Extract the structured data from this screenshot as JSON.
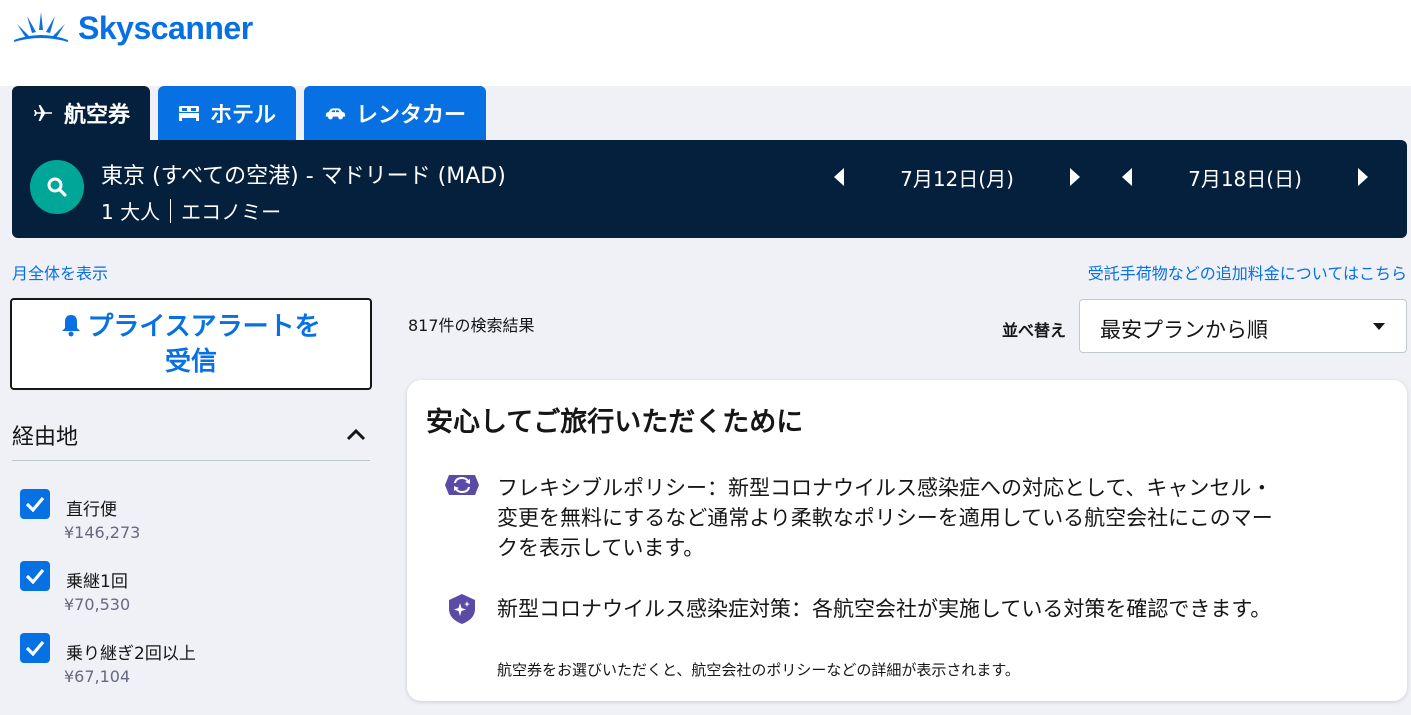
{
  "brand": {
    "name": "Skyscanner",
    "color": "#0770e3"
  },
  "tabs": [
    {
      "label": "航空券",
      "icon": "plane-icon",
      "active": true
    },
    {
      "label": "ホテル",
      "icon": "bed-icon",
      "active": false
    },
    {
      "label": "レンタカー",
      "icon": "car-icon",
      "active": false
    }
  ],
  "search": {
    "route": "東京 (すべての空港) - マドリード (MAD)",
    "passengers": "1 大人",
    "cabin": "エコノミー",
    "depart_date": "7月12日(月)",
    "return_date": "7月18日(日)"
  },
  "links": {
    "show_month": "月全体を表示",
    "extra_fees": "受託手荷物などの追加料金についてはこちら"
  },
  "price_alert": {
    "line1": "プライスアラートを",
    "line2": "受信"
  },
  "filters": {
    "stops_title": "経由地",
    "stops": [
      {
        "label": "直行便",
        "price": "¥146,273",
        "checked": true
      },
      {
        "label": "乗継1回",
        "price": "¥70,530",
        "checked": true
      },
      {
        "label": "乗り継ぎ2回以上",
        "price": "¥67,104",
        "checked": true
      }
    ]
  },
  "results": {
    "count_text": "817件の検索結果",
    "sort_label": "並べ替え",
    "sort_value": "最安プランから順"
  },
  "info_card": {
    "title": "安心してご旅行いただくために",
    "flex_policy": {
      "icon": "flexible-policy-icon",
      "line1": "フレキシブルポリシー：新型コロナウイルス感染症への対応として、キャンセル・",
      "line2": "変更を無料にするなど通常より柔軟なポリシーを適用している航空会社にこのマー",
      "line3": "クを表示しています。"
    },
    "covid_measures": {
      "icon": "shield-sparkle-icon",
      "text": "新型コロナウイルス感染症対策：各航空会社が実施している対策を確認できます。"
    },
    "note": "航空券をお選びいただくと、航空会社のポリシーなどの詳細が表示されます。"
  },
  "colors": {
    "primary": "#0770e3",
    "navy": "#05203c",
    "teal": "#00a698",
    "policy_purple": "#5c4ba6",
    "page_bg": "#eff1f7"
  }
}
